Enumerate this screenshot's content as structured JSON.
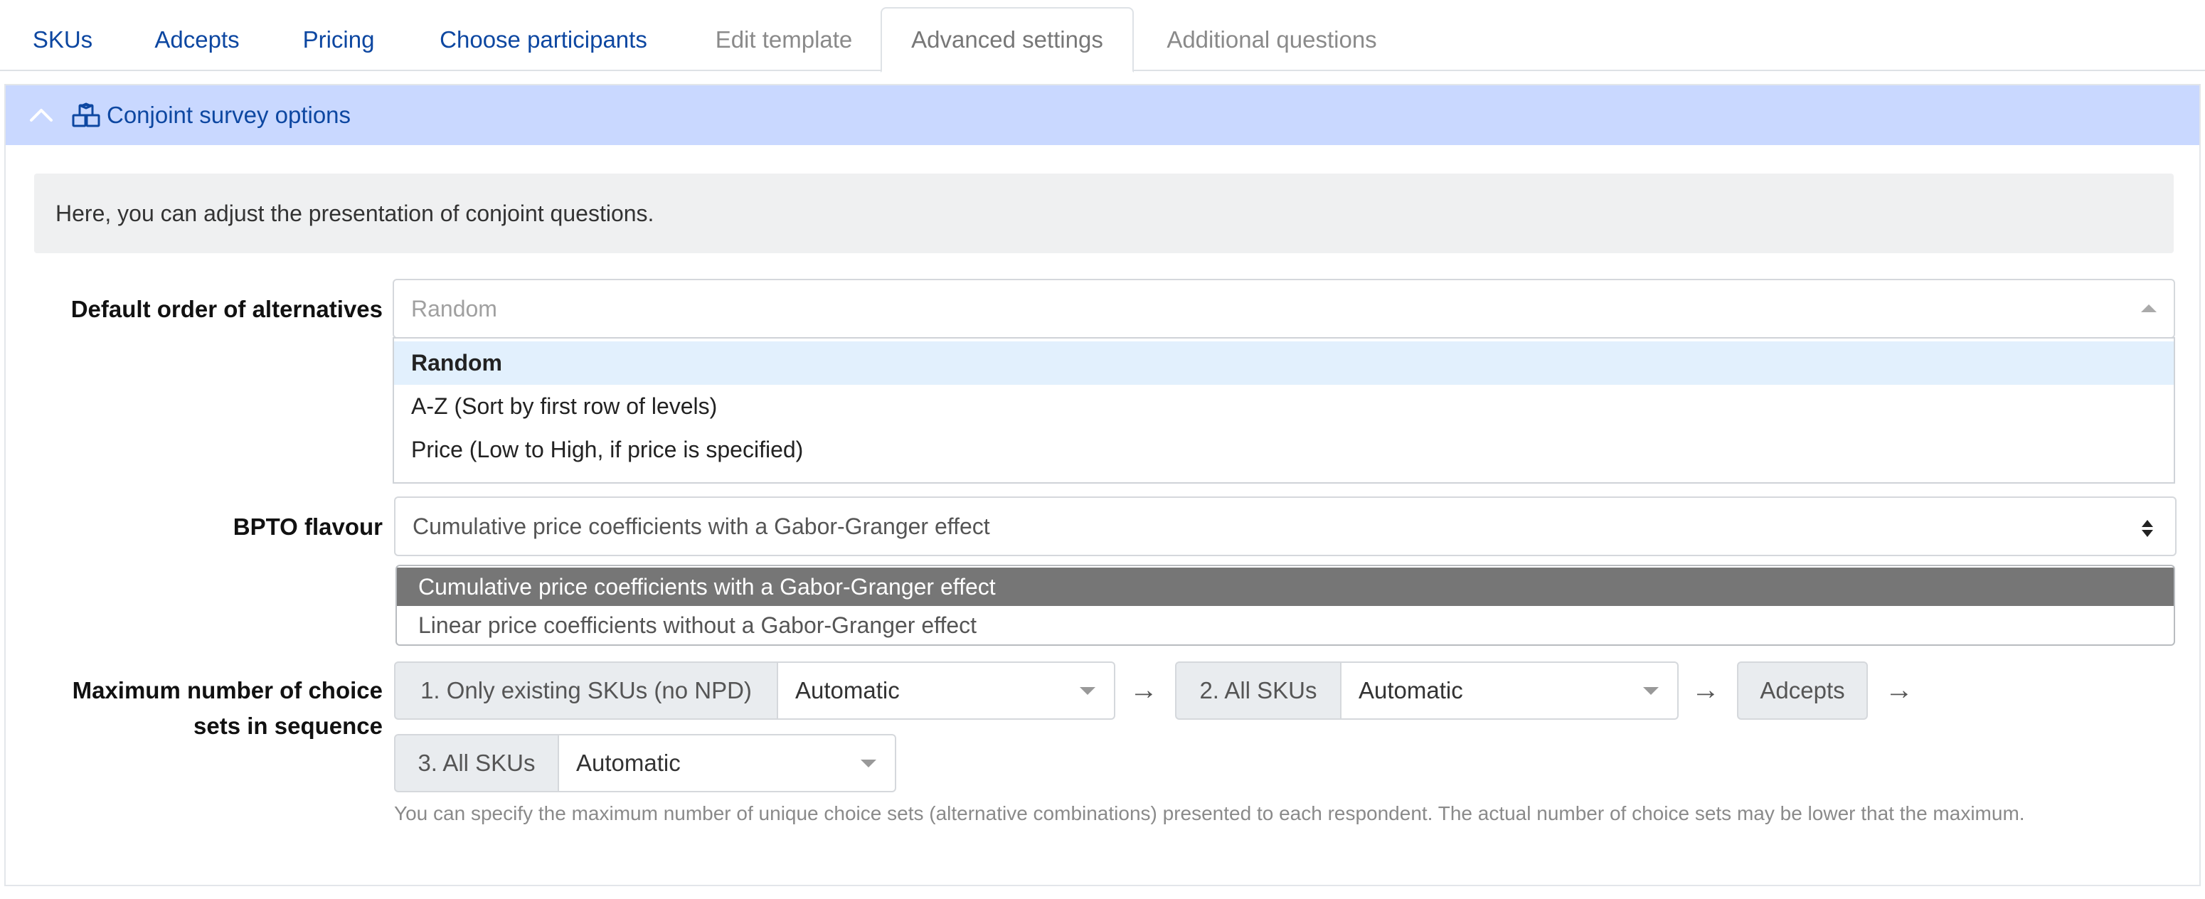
{
  "tabs": [
    {
      "label": "SKUs",
      "state": "enabled"
    },
    {
      "label": "Adcepts",
      "state": "enabled"
    },
    {
      "label": "Pricing",
      "state": "enabled"
    },
    {
      "label": "Choose participants",
      "state": "enabled"
    },
    {
      "label": "Edit template",
      "state": "disabled"
    },
    {
      "label": "Advanced settings",
      "state": "active"
    },
    {
      "label": "Additional questions",
      "state": "disabled"
    }
  ],
  "panel": {
    "title": "Conjoint survey options",
    "info": "Here, you can adjust the presentation of conjoint questions.",
    "header_color": "#c9d8ff",
    "collapse_icon": "chevron-up-icon",
    "title_icon": "cubes-icon"
  },
  "default_order": {
    "label": "Default order of alternatives",
    "placeholder": "Random",
    "options": [
      {
        "label": "Random",
        "selected": true
      },
      {
        "label": "A-Z (Sort by first row of levels)",
        "selected": false
      },
      {
        "label": "Price (Low to High, if price is specified)",
        "selected": false
      }
    ]
  },
  "bpto": {
    "label": "BPTO flavour",
    "value": "Cumulative price coefficients with a Gabor-Granger effect",
    "options": [
      {
        "label": "Cumulative price coefficients with a Gabor-Granger effect",
        "selected": true
      },
      {
        "label": "Linear price coefficients without a Gabor-Granger effect",
        "selected": false
      }
    ]
  },
  "max_choice_sets": {
    "label_line1": "Maximum number of choice",
    "label_line2": "sets in sequence",
    "arrow": "→",
    "steps": [
      {
        "label": "1. Only existing SKUs (no NPD)",
        "value": "Automatic"
      },
      {
        "label": "2. All SKUs",
        "value": "Automatic"
      },
      {
        "label": "Adcepts"
      },
      {
        "label": "3. All SKUs",
        "value": "Automatic"
      }
    ],
    "help": "You can specify the maximum number of unique choice sets (alternative combinations) presented to each respondent. The actual number of choice sets may be lower that the maximum."
  }
}
